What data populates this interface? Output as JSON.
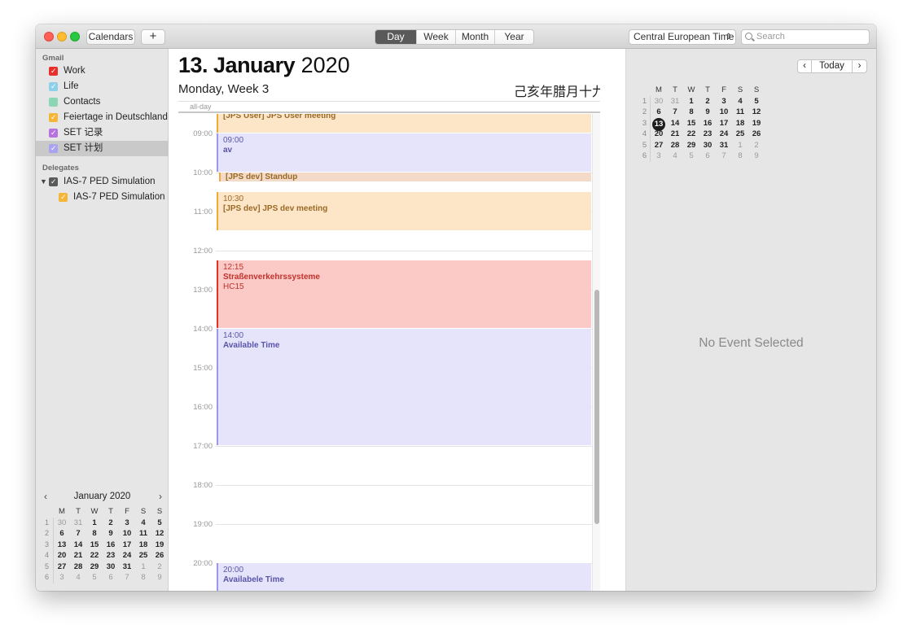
{
  "toolbar": {
    "calendars_label": "Calendars",
    "add_label": "+",
    "views": [
      "Day",
      "Week",
      "Month",
      "Year"
    ],
    "active_view": "Day",
    "timezone": "Central European Time",
    "timezone_arrows": "⌃⌄",
    "search_placeholder": "Search"
  },
  "sidebar": {
    "group_gmail": "Gmail",
    "calendars": [
      {
        "label": "Work",
        "color": "#e8302a",
        "checked": true
      },
      {
        "label": "Life",
        "color": "#8ed0ea",
        "checked": true
      },
      {
        "label": "Contacts",
        "color": "#8cd6b6",
        "checked": false
      },
      {
        "label": "Feiertage in Deutschland",
        "color": "#f5b537",
        "checked": true
      },
      {
        "label": "SET 记录",
        "color": "#b772e0",
        "checked": true
      },
      {
        "label": "SET 计划",
        "color": "#a9a3f0",
        "checked": true
      }
    ],
    "group_delegates": "Delegates",
    "delegates": [
      {
        "label": "IAS-7 PED Simulation",
        "color": "#5a5a5a",
        "checked": true
      },
      {
        "label": "IAS-7 PED Simulation",
        "color": "#f5b537",
        "checked": true
      }
    ]
  },
  "mini_calendar": {
    "month_label": "January 2020",
    "prev": "‹",
    "next": "›",
    "weekday_headers": [
      "M",
      "T",
      "W",
      "T",
      "F",
      "S",
      "S"
    ],
    "weeks": [
      {
        "wk": "1",
        "days": [
          "30",
          "31",
          "1",
          "2",
          "3",
          "4",
          "5"
        ]
      },
      {
        "wk": "2",
        "days": [
          "6",
          "7",
          "8",
          "9",
          "10",
          "11",
          "12"
        ]
      },
      {
        "wk": "3",
        "days": [
          "13",
          "14",
          "15",
          "16",
          "17",
          "18",
          "19"
        ]
      },
      {
        "wk": "4",
        "days": [
          "20",
          "21",
          "22",
          "23",
          "24",
          "25",
          "26"
        ]
      },
      {
        "wk": "5",
        "days": [
          "27",
          "28",
          "29",
          "30",
          "31",
          "1",
          "2"
        ]
      },
      {
        "wk": "6",
        "days": [
          "3",
          "4",
          "5",
          "6",
          "7",
          "8",
          "9"
        ]
      }
    ]
  },
  "day_view": {
    "date_day": "13. January",
    "date_year": "2020",
    "subtitle": "Monday, Week 3",
    "lunar_date": "己亥年腊月十九",
    "allday_label": "all-day",
    "hours": [
      "09:00",
      "10:00",
      "11:00",
      "12:00",
      "13:00",
      "14:00",
      "15:00",
      "16:00",
      "17:00",
      "18:00",
      "19:00",
      "20:00"
    ],
    "events": [
      {
        "time": "",
        "name": "[JPS User] JPS User meeting",
        "start_hour": 8.5,
        "end_hour": 9.0,
        "bg": "#fde5c8",
        "fg": "#9a6a26",
        "bar": "#f2a93b"
      },
      {
        "time": "09:00",
        "name": "av",
        "start_hour": 9.0,
        "end_hour": 10.0,
        "bg": "#e6e4fb",
        "fg": "#5a54a8",
        "bar": "#9c97ec"
      },
      {
        "time": "",
        "name": "[JPS dev] Standup",
        "start_hour": 10.0,
        "end_hour": 10.25,
        "bg": "#f4dac8",
        "fg": "#9a6a26",
        "bar": "#f2a93b"
      },
      {
        "time": "10:30",
        "name": "[JPS dev] JPS dev meeting",
        "start_hour": 10.5,
        "end_hour": 11.5,
        "bg": "#fde5c8",
        "fg": "#9a6a26",
        "bar": "#f2a93b"
      },
      {
        "time": "12:15",
        "name": "Straßenverkehrssysteme",
        "extra": "HC15",
        "start_hour": 12.25,
        "end_hour": 14.0,
        "bg": "#fccac6",
        "fg": "#c0322c",
        "bar": "#e8302a"
      },
      {
        "time": "14:00",
        "name": "Available Time",
        "start_hour": 14.0,
        "end_hour": 17.0,
        "bg": "#e6e4fb",
        "fg": "#5a54a8",
        "bar": "#9c97ec"
      },
      {
        "time": "20:00",
        "name": "Availabele Time",
        "start_hour": 20.0,
        "end_hour": 21.0,
        "bg": "#e6e4fb",
        "fg": "#5a54a8",
        "bar": "#9c97ec"
      }
    ]
  },
  "inspector": {
    "today_label": "Today",
    "prev": "‹",
    "next": "›",
    "no_event_text": "No Event Selected",
    "selected_day": "13"
  }
}
